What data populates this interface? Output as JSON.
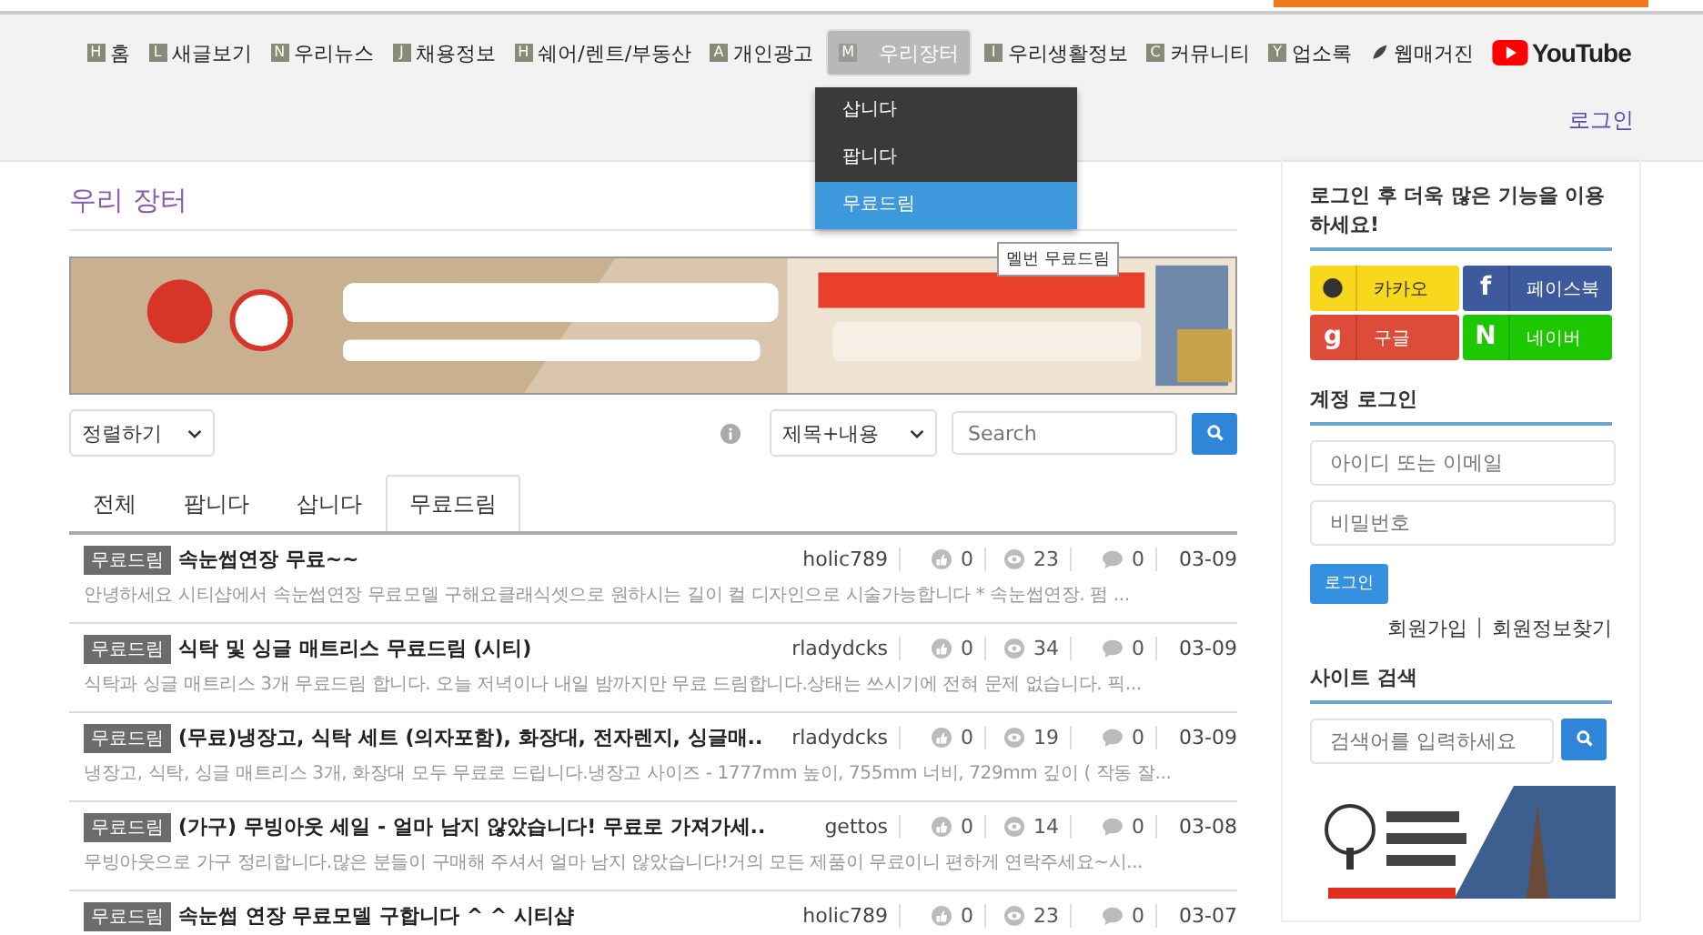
{
  "nav": [
    {
      "kind": "badge",
      "badge": "H",
      "label": "홈",
      "selected": false
    },
    {
      "kind": "badge",
      "badge": "L",
      "label": "새글보기",
      "selected": false
    },
    {
      "kind": "badge",
      "badge": "N",
      "label": "우리뉴스",
      "selected": false
    },
    {
      "kind": "badge",
      "badge": "J",
      "label": "채용정보",
      "selected": false
    },
    {
      "kind": "badge",
      "badge": "H",
      "label": "쉐어/렌트/부동산",
      "selected": false
    },
    {
      "kind": "badge",
      "badge": "A",
      "label": "개인광고",
      "selected": false
    },
    {
      "kind": "badge",
      "badge": "M",
      "label": "우리장터",
      "selected": true
    },
    {
      "kind": "badge",
      "badge": "I",
      "label": "우리생활정보",
      "selected": false
    },
    {
      "kind": "badge",
      "badge": "C",
      "label": "커뮤니티",
      "selected": false
    },
    {
      "kind": "badge",
      "badge": "Y",
      "label": "업소록",
      "selected": false
    },
    {
      "kind": "globe",
      "label": "웹매거진",
      "selected": false
    },
    {
      "kind": "youtube",
      "label": "YouTube",
      "selected": false
    }
  ],
  "dropdown": [
    {
      "label": "삽니다",
      "selected": false
    },
    {
      "label": "팝니다",
      "selected": false
    },
    {
      "label": "무료드림",
      "selected": true
    }
  ],
  "tooltip": "멜번 무료드림",
  "header_login": "로그인",
  "page_title": "우리 장터",
  "banner": {
    "kind": "picture"
  },
  "sort_select": "정렬하기",
  "search_scope": "제목+내용",
  "search": {
    "placeholder": "Search"
  },
  "tabs": [
    {
      "label": "전체",
      "selected": false
    },
    {
      "label": "팝니다",
      "selected": false
    },
    {
      "label": "삽니다",
      "selected": false
    },
    {
      "label": "무료드림",
      "selected": true
    }
  ],
  "posts": [
    {
      "tag": "무료드림",
      "title": "속눈썹연장 무료~~",
      "excerpt": "안녕하세요 시티샵에서 속눈썹연장 무료모델 구해요클래식셋으로 원하시는 길이 컬 디자인으로 시술가능합니다 * 속눈썹연장. 펌 ...",
      "author": "holic789",
      "likes": "0",
      "views": "23",
      "comments": "0",
      "date": "03-09"
    },
    {
      "tag": "무료드림",
      "title": "식탁 및 싱글 매트리스 무료드림 (시티)",
      "excerpt": "식탁과 싱글 매트리스 3개 무료드림 합니다. 오늘 저녁이나 내일 밤까지만 무료 드림합니다.상태는 쓰시기에 전혀 문제 없습니다. 픽...",
      "author": "rladydcks",
      "likes": "0",
      "views": "34",
      "comments": "0",
      "date": "03-09"
    },
    {
      "tag": "무료드림",
      "title": "(무료)냉장고, 식탁 세트 (의자포함), 화장대, 전자렌지, 싱글매..",
      "excerpt": "냉장고, 식탁, 싱글 매트리스 3개, 화장대 모두 무료로 드립니다.냉장고 사이즈 - 1777mm 높이, 755mm 너비, 729mm 깊이 ( 작동 잘...",
      "author": "rladydcks",
      "likes": "0",
      "views": "19",
      "comments": "0",
      "date": "03-09"
    },
    {
      "tag": "무료드림",
      "title": "(가구) 무빙아웃 세일 - 얼마 남지 않았습니다! 무료로 가져가세..",
      "excerpt": "무빙아웃으로 가구 정리합니다.많은 분들이 구매해 주셔서 얼마 남지 않았습니다!거의 모든 제품이 무료이니 편하게 연락주세요~시...",
      "author": "gettos",
      "likes": "0",
      "views": "14",
      "comments": "0",
      "date": "03-08"
    },
    {
      "tag": "무료드림",
      "title": "속눈썹 연장 무료모델 구합니다 ^ ^ 시티샵",
      "author": "holic789",
      "likes": "0",
      "views": "23",
      "comments": "0",
      "date": "03-07"
    }
  ],
  "sidebar": {
    "prompt": "로그인 후 더욱 많은 기능을 이용하세요!",
    "social": [
      {
        "icon": "●",
        "label": "카카오",
        "color": "#f7d81c"
      },
      {
        "icon": "f",
        "label": "페이스북",
        "color": "#3d5a9c"
      },
      {
        "icon": "g",
        "label": "구글",
        "color": "#dd4b39"
      },
      {
        "icon": "N",
        "label": "네이버",
        "color": "#1ec800"
      }
    ],
    "account_heading": "계정 로그인",
    "id_field": {
      "placeholder": "아이디 또는 이메일"
    },
    "pw_field": {
      "placeholder": "비밀번호"
    },
    "login_button": "로그인",
    "links": [
      "회원가입",
      "회원정보찾기"
    ],
    "link_separator": "|",
    "search_heading": "사이트 검색",
    "search_field": {
      "placeholder": "검색어를 입력하세요"
    },
    "ad": {
      "kind": "picture"
    }
  }
}
